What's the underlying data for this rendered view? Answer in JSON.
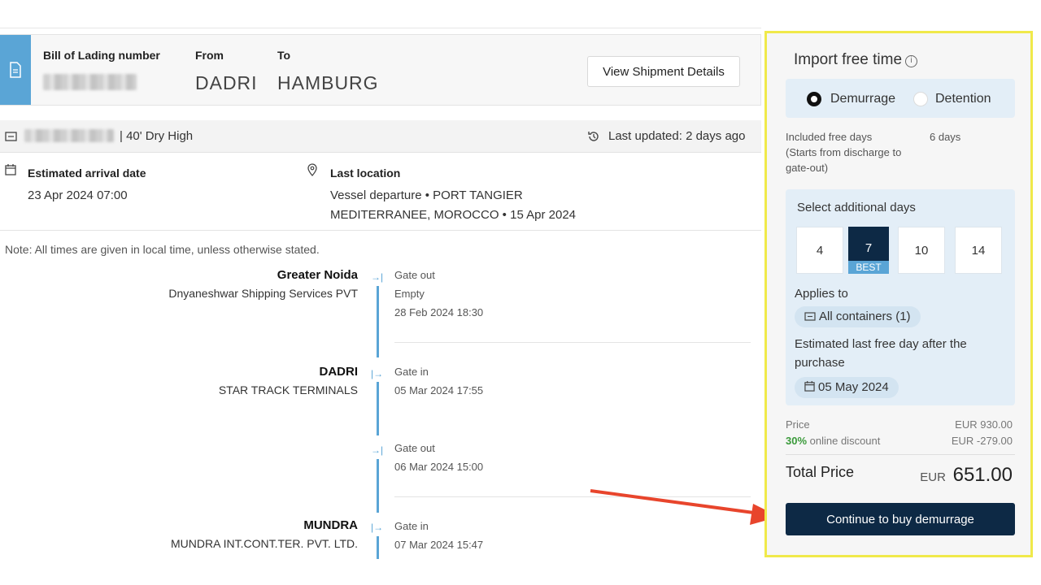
{
  "shipment": {
    "bol_label": "Bill of Lading number",
    "from_label": "From",
    "to_label": "To",
    "from_city": "DADRI",
    "to_city": "HAMBURG",
    "view_details_label": "View Shipment Details"
  },
  "container": {
    "type": "| 40' Dry High",
    "last_updated": "Last updated: 2 days ago"
  },
  "arrival": {
    "label": "Estimated arrival date",
    "value": "23 Apr 2024 07:00"
  },
  "last_location": {
    "label": "Last location",
    "line1": "Vessel departure • PORT TANGIER",
    "line2": "MEDITERRANEE, MOROCCO • 15 Apr 2024"
  },
  "note": "Note: All times are given in local time, unless otherwise stated.",
  "timeline": [
    {
      "place": "Greater Noida",
      "facility": "Dnyaneshwar Shipping Services PVT",
      "event": "Gate out",
      "detail": "Empty",
      "time": "28 Feb 2024 18:30"
    },
    {
      "place": "DADRI",
      "facility": "STAR TRACK TERMINALS",
      "event": "Gate in",
      "detail": "",
      "time": "05 Mar 2024 17:55"
    },
    {
      "place": "",
      "facility": "",
      "event": "Gate out",
      "detail": "",
      "time": "06 Mar 2024 15:00"
    },
    {
      "place": "MUNDRA",
      "facility": "MUNDRA INT.CONT.TER. PVT. LTD.",
      "event": "Gate in",
      "detail": "",
      "time": "07 Mar 2024 15:47"
    }
  ],
  "panel": {
    "title": "Import free time",
    "info_symbol": "i",
    "demurrage_label": "Demurrage",
    "detention_label": "Detention",
    "included_label_1": "Included free days",
    "included_label_2": "(Starts from discharge to",
    "included_label_3": "gate-out)",
    "included_value": "6 days",
    "select_label": "Select additional days",
    "days": [
      "4",
      "7",
      "10",
      "14"
    ],
    "best_label": "BEST",
    "applies_label": "Applies to",
    "applies_value": "All containers (1)",
    "est_label_1": "Estimated last free day after the",
    "est_label_2": "purchase",
    "est_value": "05 May 2024",
    "price_label": "Price",
    "price_value": "EUR 930.00",
    "discount_pct": "30%",
    "discount_label": " online discount",
    "discount_value": "EUR -279.00",
    "total_label": "Total Price",
    "total_currency": "EUR",
    "total_value": "651.00",
    "cta_label": "Continue to buy demurrage"
  },
  "colors": {
    "accent_blue": "#5aa5d6",
    "navy": "#0d2945",
    "highlight_yellow": "#f0e94a",
    "annotation_red": "#e8452c"
  }
}
